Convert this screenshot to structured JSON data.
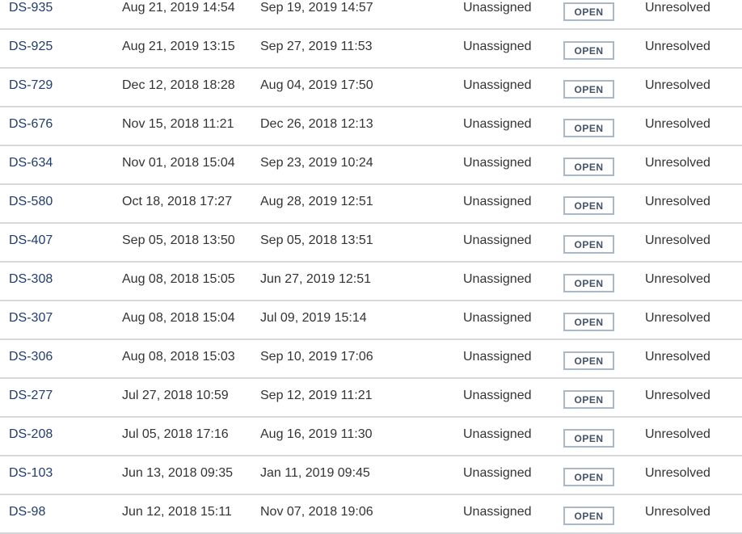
{
  "rows": [
    {
      "key": "DS-935",
      "created": "Aug 21, 2019 14:54",
      "updated": "Sep 19, 2019 14:57",
      "assignee": "Unassigned",
      "status": "OPEN",
      "resolution": "Unresolved"
    },
    {
      "key": "DS-925",
      "created": "Aug 21, 2019 13:15",
      "updated": "Sep 27, 2019 11:53",
      "assignee": "Unassigned",
      "status": "OPEN",
      "resolution": "Unresolved"
    },
    {
      "key": "DS-729",
      "created": "Dec 12, 2018 18:28",
      "updated": "Aug 04, 2019 17:50",
      "assignee": "Unassigned",
      "status": "OPEN",
      "resolution": "Unresolved"
    },
    {
      "key": "DS-676",
      "created": "Nov 15, 2018 11:21",
      "updated": "Dec 26, 2018 12:13",
      "assignee": "Unassigned",
      "status": "OPEN",
      "resolution": "Unresolved"
    },
    {
      "key": "DS-634",
      "created": "Nov 01, 2018 15:04",
      "updated": "Sep 23, 2019 10:24",
      "assignee": "Unassigned",
      "status": "OPEN",
      "resolution": "Unresolved"
    },
    {
      "key": "DS-580",
      "created": "Oct 18, 2018 17:27",
      "updated": "Aug 28, 2019 12:51",
      "assignee": "Unassigned",
      "status": "OPEN",
      "resolution": "Unresolved"
    },
    {
      "key": "DS-407",
      "created": "Sep 05, 2018 13:50",
      "updated": "Sep 05, 2018 13:51",
      "assignee": "Unassigned",
      "status": "OPEN",
      "resolution": "Unresolved"
    },
    {
      "key": "DS-308",
      "created": "Aug 08, 2018 15:05",
      "updated": "Jun 27, 2019 12:51",
      "assignee": "Unassigned",
      "status": "OPEN",
      "resolution": "Unresolved"
    },
    {
      "key": "DS-307",
      "created": "Aug 08, 2018 15:04",
      "updated": "Jul 09, 2019 15:14",
      "assignee": "Unassigned",
      "status": "OPEN",
      "resolution": "Unresolved"
    },
    {
      "key": "DS-306",
      "created": "Aug 08, 2018 15:03",
      "updated": "Sep 10, 2019 17:06",
      "assignee": "Unassigned",
      "status": "OPEN",
      "resolution": "Unresolved"
    },
    {
      "key": "DS-277",
      "created": "Jul 27, 2018 10:59",
      "updated": "Sep 12, 2019 11:21",
      "assignee": "Unassigned",
      "status": "OPEN",
      "resolution": "Unresolved"
    },
    {
      "key": "DS-208",
      "created": "Jul 05, 2018 17:16",
      "updated": "Aug 16, 2019 11:30",
      "assignee": "Unassigned",
      "status": "OPEN",
      "resolution": "Unresolved"
    },
    {
      "key": "DS-103",
      "created": "Jun 13, 2018 09:35",
      "updated": "Jan 11, 2019 09:45",
      "assignee": "Unassigned",
      "status": "OPEN",
      "resolution": "Unresolved"
    },
    {
      "key": "DS-98",
      "created": "Jun 12, 2018 15:11",
      "updated": "Nov 07, 2018 19:06",
      "assignee": "Unassigned",
      "status": "OPEN",
      "resolution": "Unresolved"
    }
  ]
}
